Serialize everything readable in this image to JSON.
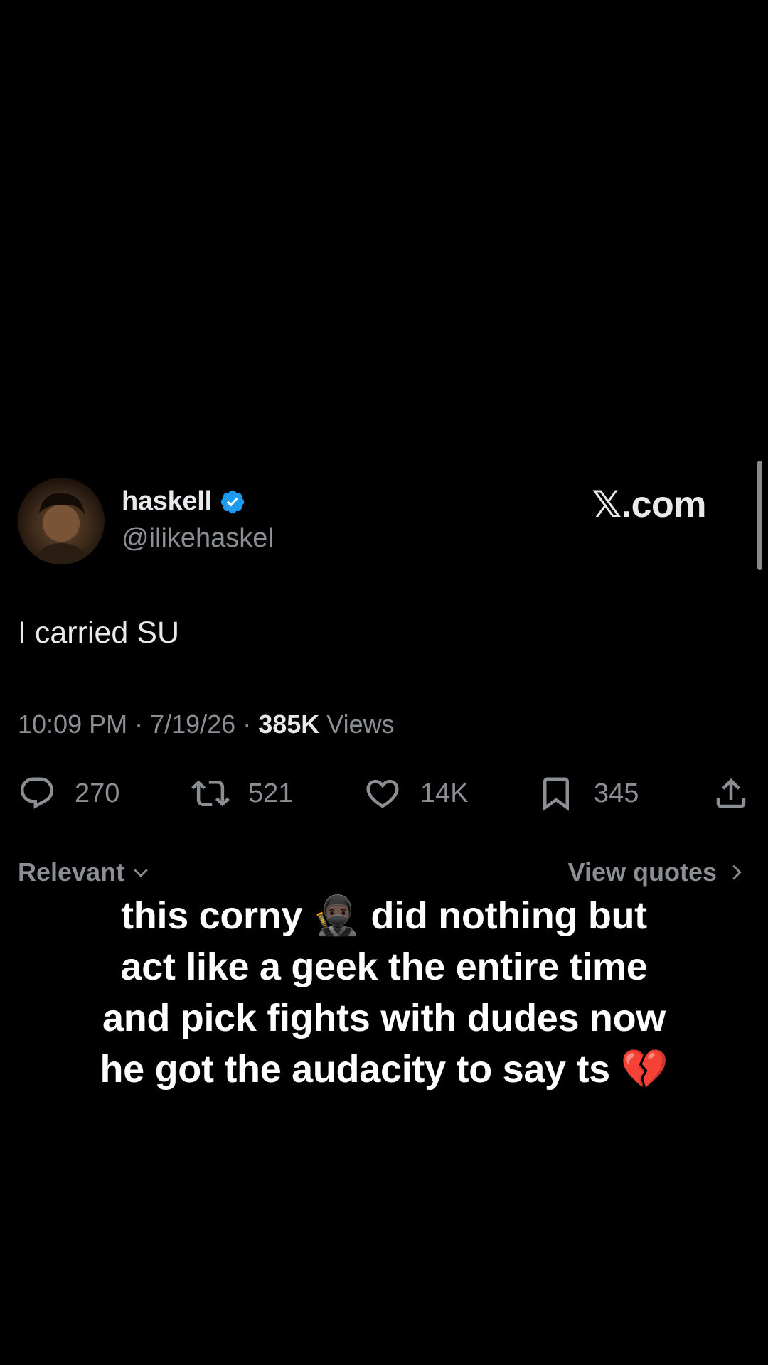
{
  "post": {
    "author": {
      "display_name": "haskell",
      "handle": "@ilikehaskel",
      "verified": true
    },
    "brand": "𝕏.com",
    "text": "I carried SU",
    "meta": {
      "time": "10:09 PM",
      "sep1": " · ",
      "date": "7/19/26",
      "sep2": " · ",
      "views_count": "385K",
      "views_label": " Views"
    },
    "actions": {
      "reply_count": "270",
      "retweet_count": "521",
      "like_count": "14K",
      "bookmark_count": "345"
    },
    "sort": {
      "label": "Relevant",
      "view_quotes": "View quotes"
    }
  },
  "overlay": {
    "caption": "this corny 🥷🏿 did nothing but act like a geek the entire time and pick fights with dudes now he got the audacity to say ts 💔"
  },
  "colors": {
    "background": "#000000",
    "primary_text": "#e7e9ea",
    "secondary_text": "#8b8f94",
    "verified_badge": "#1d9bf0"
  },
  "icons": [
    "verified-badge-icon",
    "reply-icon",
    "retweet-icon",
    "like-icon",
    "bookmark-icon",
    "share-icon",
    "chevron-down-icon",
    "chevron-right-icon"
  ]
}
